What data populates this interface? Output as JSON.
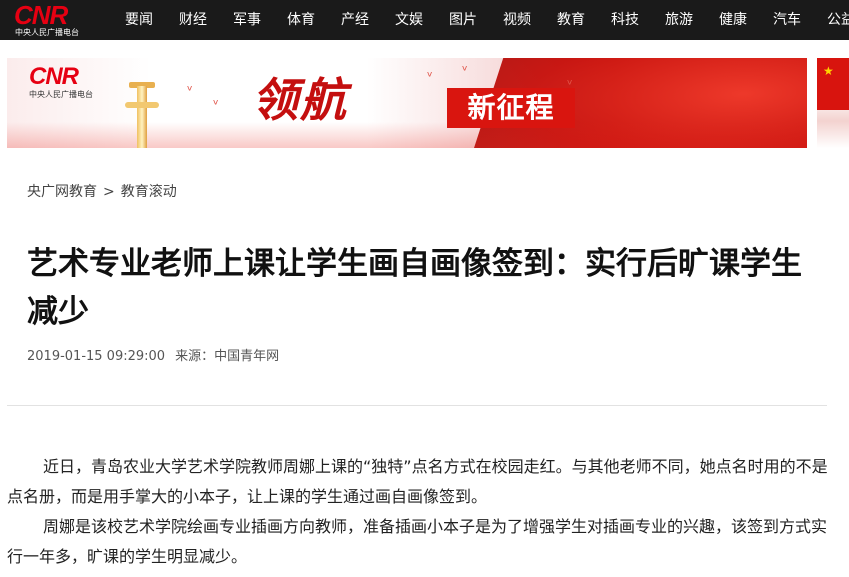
{
  "header": {
    "logo_text": "CNR",
    "logo_subtitle": "中央人民广播电台",
    "nav_items": [
      "要闻",
      "财经",
      "军事",
      "体育",
      "产经",
      "文娱",
      "图片",
      "视频",
      "教育",
      "科技",
      "旅游",
      "健康",
      "汽车",
      "公益"
    ]
  },
  "banner": {
    "logo_text": "CNR",
    "logo_subtitle": "中央人民广播电台",
    "title_part1": "领航",
    "title_part2": "新征程"
  },
  "breadcrumb": {
    "items": [
      "央广网教育",
      "教育滚动"
    ],
    "separator": ">"
  },
  "article": {
    "title": "艺术专业老师上课让学生画自画像签到：实行后旷课学生减少",
    "datetime": "2019-01-15 09:29:00",
    "source": "来源：中国青年网",
    "paragraphs": [
      "近日，青岛农业大学艺术学院教师周娜上课的“独特”点名方式在校园走红。与其他老师不同，她点名时用的不是点名册，而是用手掌大的小本子，让上课的学生通过画自画像签到。",
      "周娜是该校艺术学院绘画专业插画方向教师，准备插画小本子是为了增强学生对插画专业的兴趣，该签到方式实行一年多，旷课的学生明显减少。"
    ]
  },
  "colors": {
    "topbar": "#1a1a1a",
    "brand_red": "#e60012",
    "banner_red": "#d9150f"
  }
}
